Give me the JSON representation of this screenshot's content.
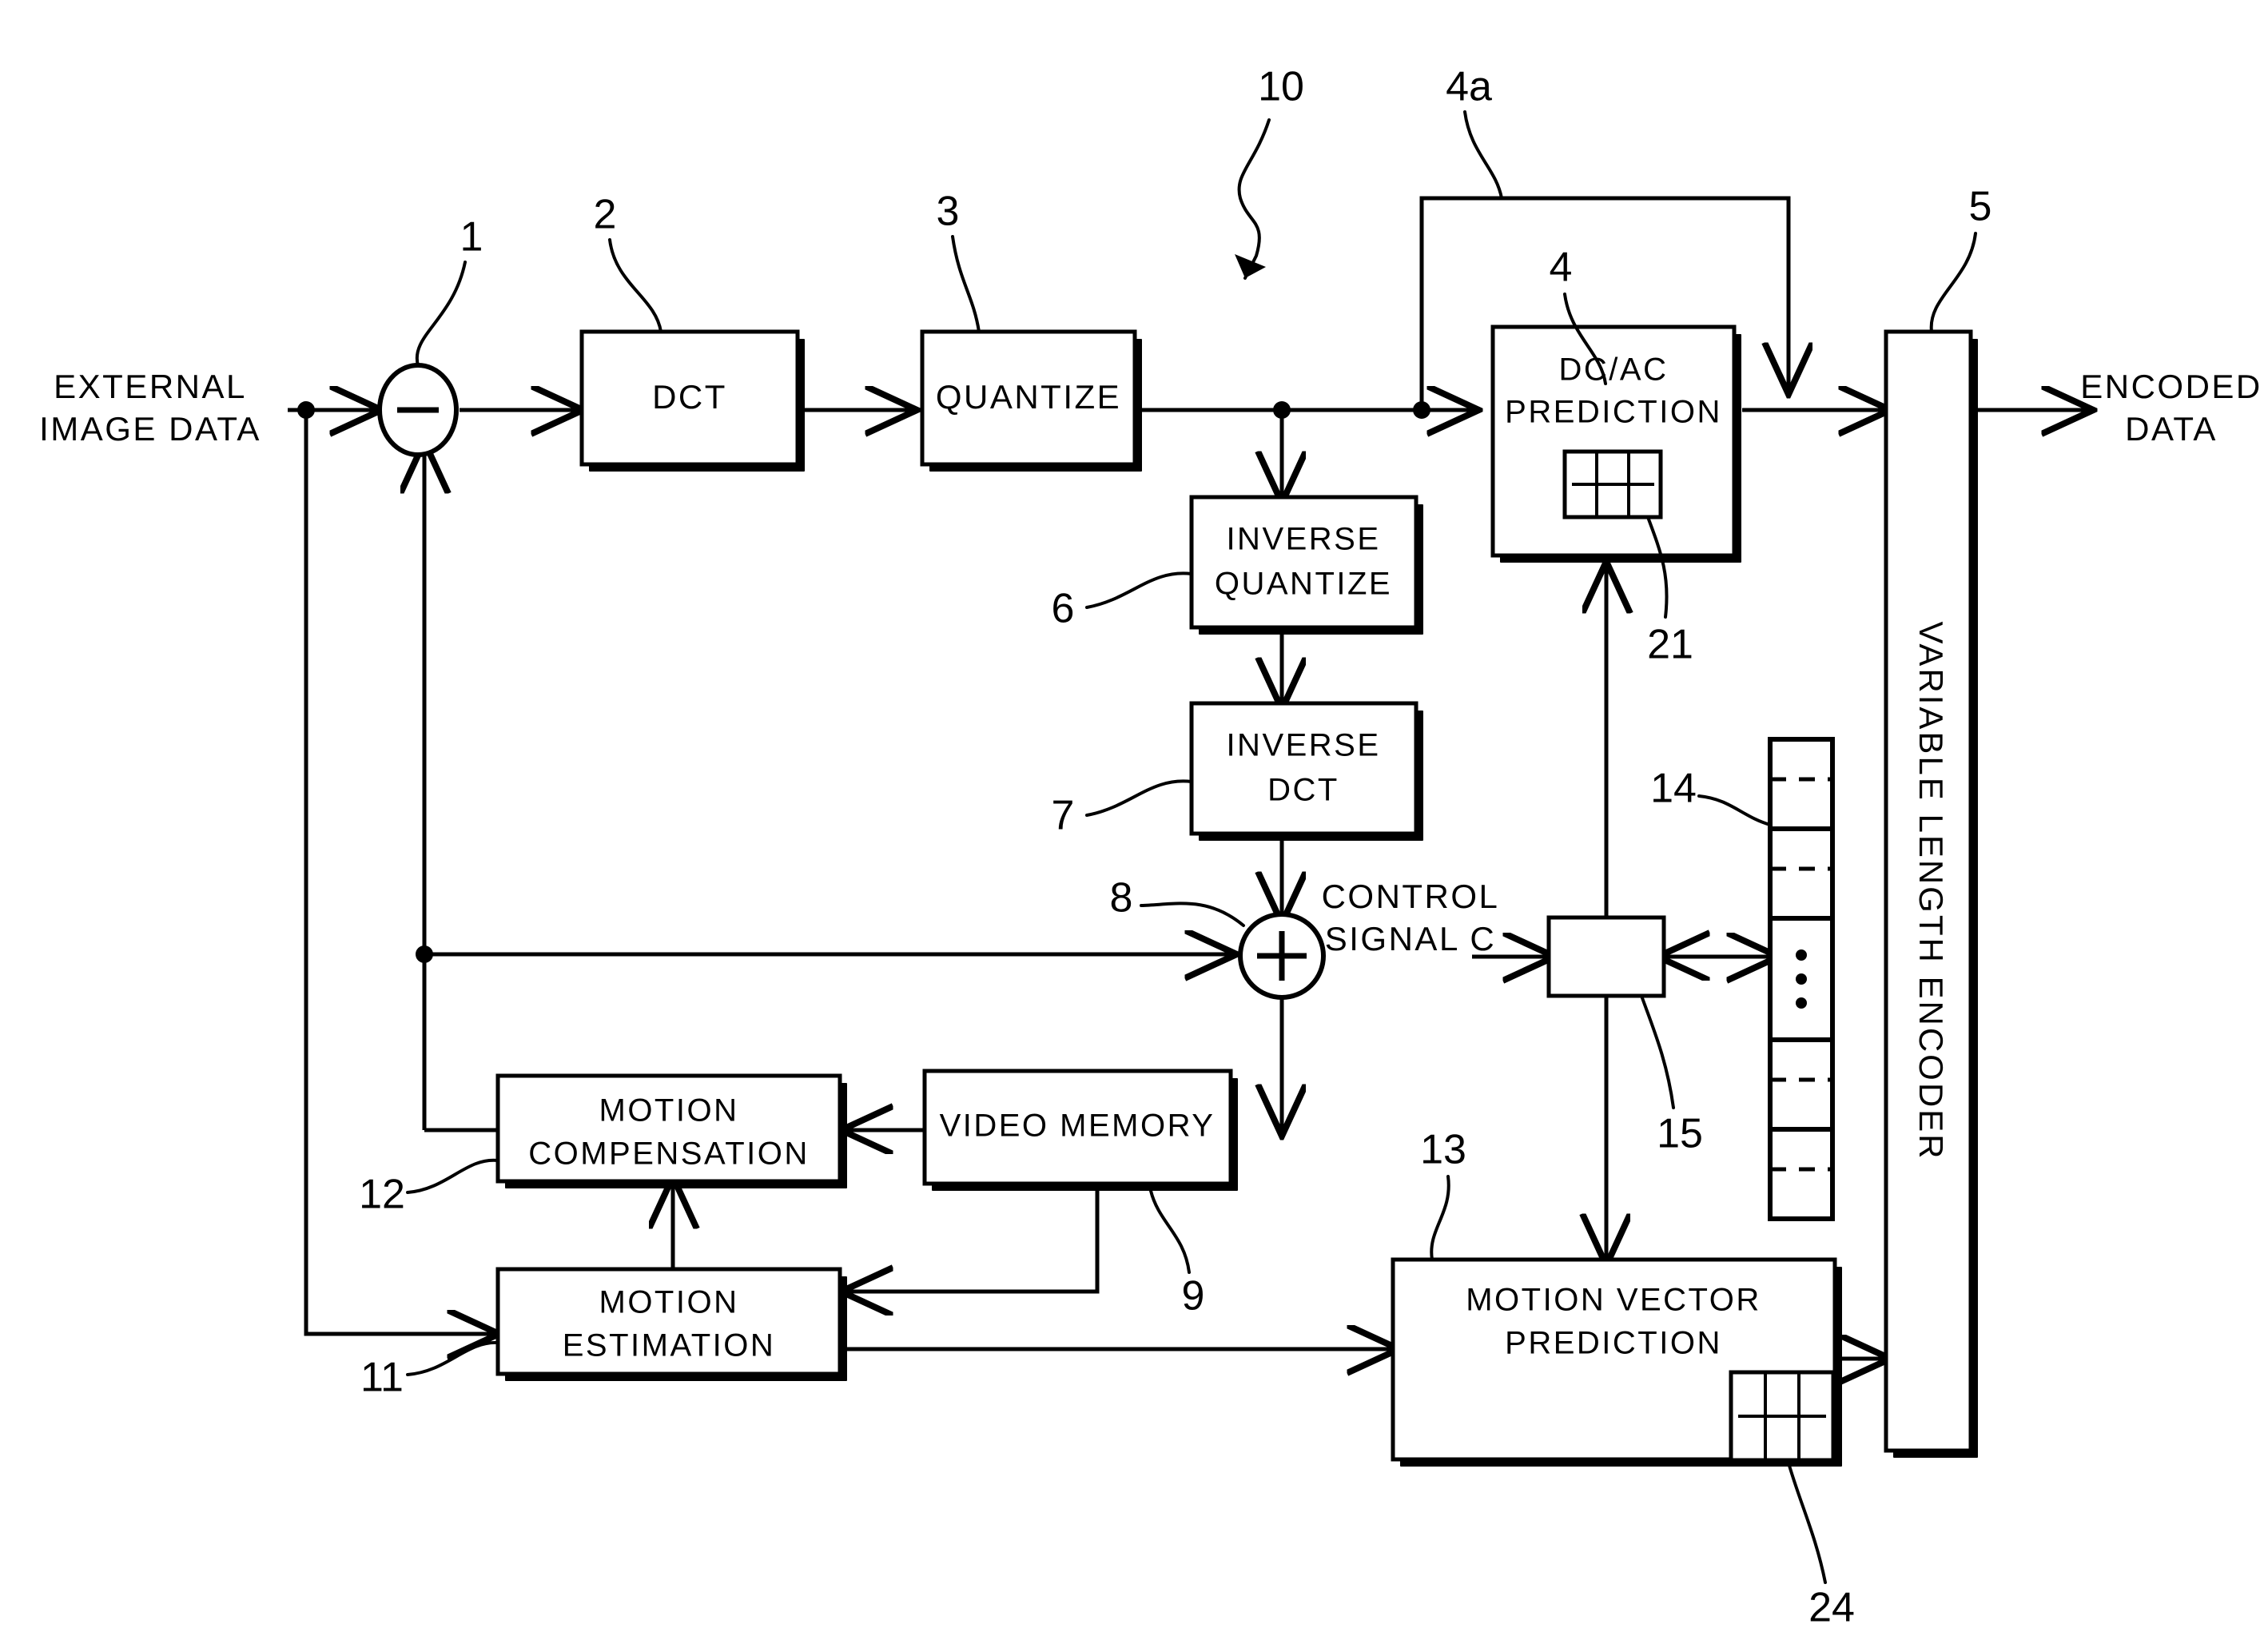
{
  "figure": {
    "type": "patent-block-diagram",
    "title": "Video encoding apparatus block diagram",
    "system_ref": "10"
  },
  "io_labels": {
    "input_line1": "EXTERNAL",
    "input_line2": "IMAGE DATA",
    "output_line1": "ENCODED",
    "output_line2": "DATA",
    "control_line1": "CONTROL",
    "control_line2": "SIGNAL C"
  },
  "blocks": [
    {
      "id": "dct",
      "ref": "2",
      "line1": "DCT",
      "line2": ""
    },
    {
      "id": "quantize",
      "ref": "3",
      "line1": "QUANTIZE",
      "line2": ""
    },
    {
      "id": "dcac",
      "ref": "4",
      "line1": "DC/AC",
      "line2": "PREDICTION"
    },
    {
      "id": "vlc",
      "ref": "5",
      "line1": "VARIABLE LENGTH ENCODER",
      "line2": ""
    },
    {
      "id": "iquant",
      "ref": "6",
      "line1": "INVERSE",
      "line2": "QUANTIZE"
    },
    {
      "id": "idct",
      "ref": "7",
      "line1": "INVERSE",
      "line2": "DCT"
    },
    {
      "id": "vmem",
      "ref": "9",
      "line1": "VIDEO MEMORY",
      "line2": ""
    },
    {
      "id": "mest",
      "ref": "11",
      "line1": "MOTION",
      "line2": "ESTIMATION"
    },
    {
      "id": "mcomp",
      "ref": "12",
      "line1": "MOTION",
      "line2": "COMPENSATION"
    },
    {
      "id": "mvp",
      "ref": "13",
      "line1": "MOTION VECTOR",
      "line2": "PREDICTION"
    },
    {
      "id": "ctrl",
      "ref": "15",
      "line1": "",
      "line2": ""
    }
  ],
  "operators": [
    {
      "id": "subtractor",
      "ref": "1",
      "symbol": "−"
    },
    {
      "id": "adder",
      "ref": "8",
      "symbol": "+"
    }
  ],
  "ref_numbers": {
    "subtractor": "1",
    "dct": "2",
    "quantize": "3",
    "dcac_prediction": "4",
    "dcac_feedback_path": "4a",
    "vlc": "5",
    "inverse_quantize": "6",
    "inverse_dct": "7",
    "adder": "8",
    "video_memory": "9",
    "system": "10",
    "motion_estimation": "11",
    "motion_compensation": "12",
    "motion_vector_prediction": "13",
    "memory_array": "14",
    "control_unit": "15",
    "dcac_grid_icon": "21",
    "mvp_grid_icon": "24"
  },
  "icons": {
    "dcac_grid": "macroblock-grid-icon",
    "mvp_grid": "macroblock-grid-icon",
    "memory_array": "memory-array-icon",
    "subtractor": "minus-circle-icon",
    "adder": "plus-circle-icon"
  },
  "colors": {
    "stroke": "#000000",
    "fill": "#ffffff"
  }
}
